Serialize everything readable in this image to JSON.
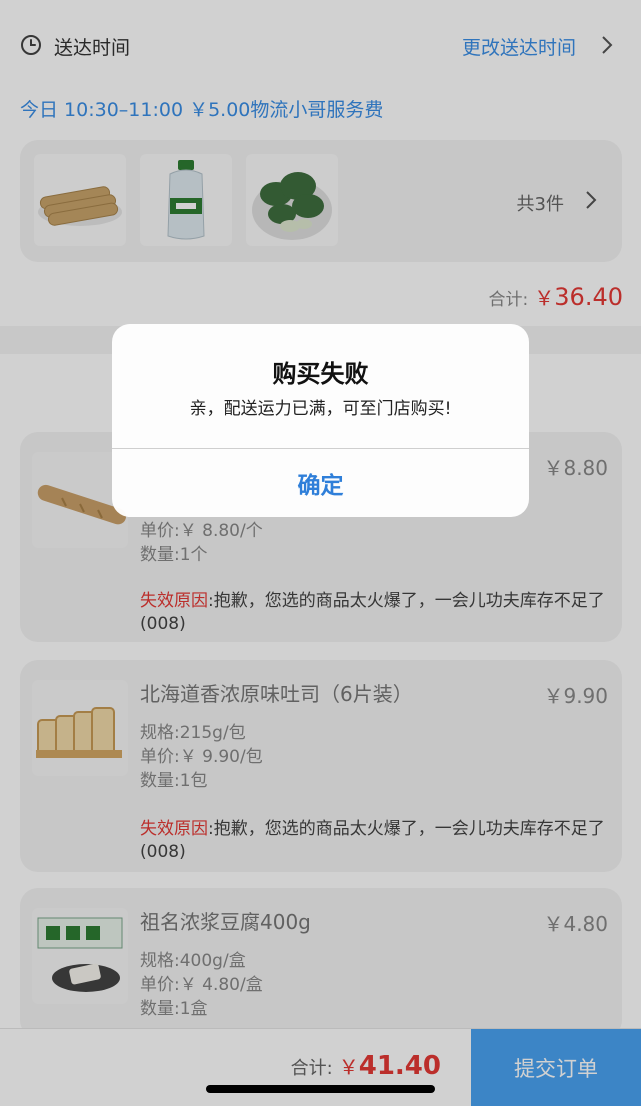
{
  "delivery": {
    "label": "送达时间",
    "change_link": "更改送达时间",
    "slot": "今日 10:30–11:00 ￥5.00物流小哥服务费"
  },
  "goods_strip": {
    "count": "共3件",
    "thumbs": [
      "bread-rolls",
      "water-bottle",
      "bok-choy"
    ]
  },
  "subtotal1": {
    "label": "合计:",
    "currency": "￥",
    "amount": "36.40"
  },
  "items": [
    {
      "name": "",
      "price": "￥8.80",
      "unit_price": "单价:￥ 8.80/个",
      "qty": "数量:1个",
      "reason_label": "失效原因",
      "reason": ":抱歉，您选的商品太火爆了，一会儿功夫库存不足了(008)"
    },
    {
      "name": "北海道香浓原味吐司（6片装）",
      "price": "￥9.90",
      "spec": "规格:215g/包",
      "unit_price": "单价:￥ 9.90/包",
      "qty": "数量:1包",
      "reason_label": "失效原因",
      "reason": ":抱歉，您选的商品太火爆了，一会儿功夫库存不足了(008)"
    },
    {
      "name": "祖名浓浆豆腐400g",
      "price": "￥4.80",
      "spec": "规格:400g/盒",
      "unit_price": "单价:￥ 4.80/盒",
      "qty": "数量:1盒"
    }
  ],
  "bottom": {
    "total_label": "合计:",
    "currency": "￥",
    "amount": "41.40",
    "submit": "提交订单"
  },
  "dialog": {
    "title": "购买失败",
    "message": "亲，配送运力已满，可至门店购买!",
    "confirm": "确定"
  },
  "colors": {
    "accent": "#3a8ee6",
    "price_red": "#e53935",
    "submit_bg": "#4aa3f2"
  }
}
